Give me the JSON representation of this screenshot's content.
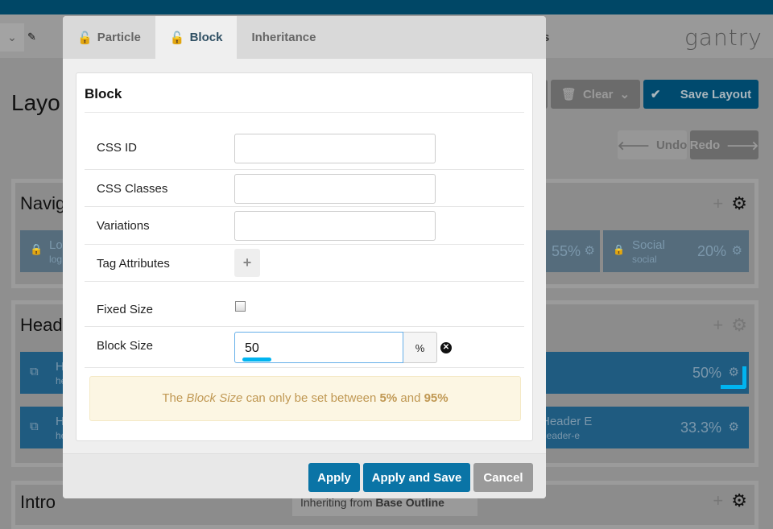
{
  "background": {
    "logo": "gantry",
    "page_title": "Layo",
    "tab_fragment": "s",
    "toolbar": {
      "clear_label": "Clear",
      "save_layout_label": "Save Layout",
      "undo_label": "Undo",
      "redo_label": "Redo"
    },
    "sections": [
      {
        "title": "Navig",
        "blocks": [
          {
            "name": "Lo",
            "id": "log",
            "size": ""
          },
          {
            "name": "",
            "id": "",
            "size": "55%"
          },
          {
            "name": "Social",
            "id": "social",
            "size": "20%"
          }
        ]
      },
      {
        "title": "Head",
        "blocks": [
          {
            "name": "H",
            "id": "he",
            "size": "50%"
          },
          {
            "name": "H",
            "id": "he",
            "size": ""
          },
          {
            "name": "Header E",
            "id": "header-e",
            "size": "33.3%"
          }
        ]
      },
      {
        "title": "Intro",
        "inherit_prefix": "Inheriting from",
        "inherit_name": "Base Outline"
      }
    ]
  },
  "modal": {
    "tabs": [
      {
        "label": "Particle",
        "icon": "unlock-icon",
        "active": false
      },
      {
        "label": "Block",
        "icon": "unlock-icon",
        "active": true
      },
      {
        "label": "Inheritance",
        "active": false
      }
    ],
    "card_title": "Block",
    "fields": {
      "css_id": {
        "label": "CSS ID",
        "value": ""
      },
      "css_classes": {
        "label": "CSS Classes",
        "value": ""
      },
      "variations": {
        "label": "Variations",
        "value": ""
      },
      "tag_attributes": {
        "label": "Tag Attributes",
        "add": "+"
      },
      "fixed_size": {
        "label": "Fixed Size",
        "checked": false
      },
      "block_size": {
        "label": "Block Size",
        "value": "50",
        "unit": "%"
      }
    },
    "alert": {
      "pre": "The ",
      "em": "Block Size",
      "mid": " can only be set between ",
      "min": "5%",
      "and": " and ",
      "max": "95%"
    },
    "buttons": {
      "apply": "Apply",
      "apply_save": "Apply and Save",
      "cancel": "Cancel"
    }
  },
  "colors": {
    "primary": "#0a74a6",
    "highlight": "#00b4f0",
    "alert_text": "#c09853"
  }
}
